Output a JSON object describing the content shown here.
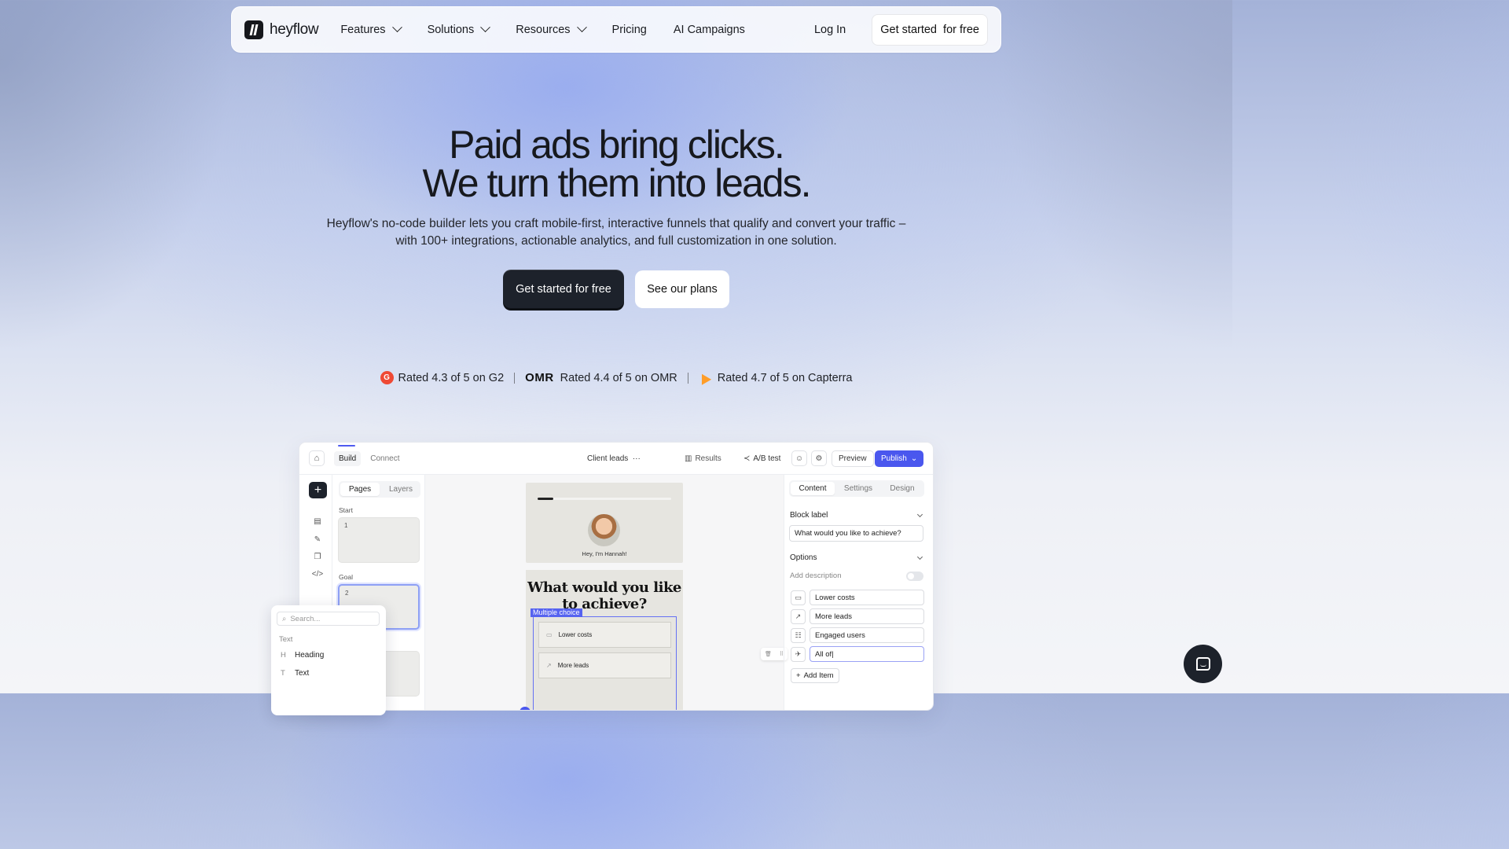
{
  "nav": {
    "brand": "heyflow",
    "items": [
      {
        "label": "Features",
        "dropdown": true
      },
      {
        "label": "Solutions",
        "dropdown": true
      },
      {
        "label": "Resources",
        "dropdown": true
      },
      {
        "label": "Pricing",
        "dropdown": false
      },
      {
        "label": "AI Campaigns",
        "dropdown": false
      }
    ],
    "login": "Log In",
    "cta": "Get started  for free"
  },
  "hero": {
    "title_line1": "Paid ads bring clicks.",
    "title_line2": "We turn them into leads.",
    "subtitle_line1": "Heyflow's no-code builder lets you craft mobile-first, interactive funnels that qualify and convert your traffic –",
    "subtitle_line2": "with 100+ integrations, actionable analytics, and full customization in one solution.",
    "primary_button": "Get started for free",
    "secondary_button": "See our plans"
  },
  "ratings": [
    {
      "icon": "g2-icon",
      "text": "Rated 4.3 of 5 on G2"
    },
    {
      "icon": "omr-logo",
      "logo_text": "OMR",
      "text": "Rated 4.4 of 5 on OMR"
    },
    {
      "icon": "capterra-icon",
      "text": "Rated 4.7 of 5 on Capterra"
    }
  ],
  "app": {
    "tabs": [
      "Build",
      "Connect"
    ],
    "flow_name": "Client leads",
    "flow_menu": "···",
    "results": "Results",
    "ab_test": "A/B test",
    "preview": "Preview",
    "publish": "Publish",
    "left_tabs": [
      "Pages",
      "Layers"
    ],
    "page_groups": [
      "Start",
      "Goal"
    ],
    "page_numbers": [
      "1",
      "2"
    ],
    "canvas": {
      "greeting": "Hey, I'm Hannah!",
      "question": "What would you like to achieve?",
      "block_tag": "Multiple choice",
      "choices": [
        "Lower costs",
        "More leads"
      ]
    },
    "props": {
      "tabs": [
        "Content",
        "Settings",
        "Design"
      ],
      "block_label_title": "Block label",
      "block_label_value": "What would you like to achieve?",
      "options_title": "Options",
      "add_description": "Add description",
      "options": [
        "Lower costs",
        "More leads",
        "Engaged users",
        "All of|"
      ],
      "add_item": "Add Item"
    },
    "search_panel": {
      "placeholder": "Search...",
      "section": "Text",
      "items": [
        "Heading",
        "Text"
      ]
    }
  },
  "colors": {
    "accent": "#4a57ee",
    "dark": "#1d222b",
    "g2": "#ef4a35",
    "capterra": "#ff9d28"
  }
}
